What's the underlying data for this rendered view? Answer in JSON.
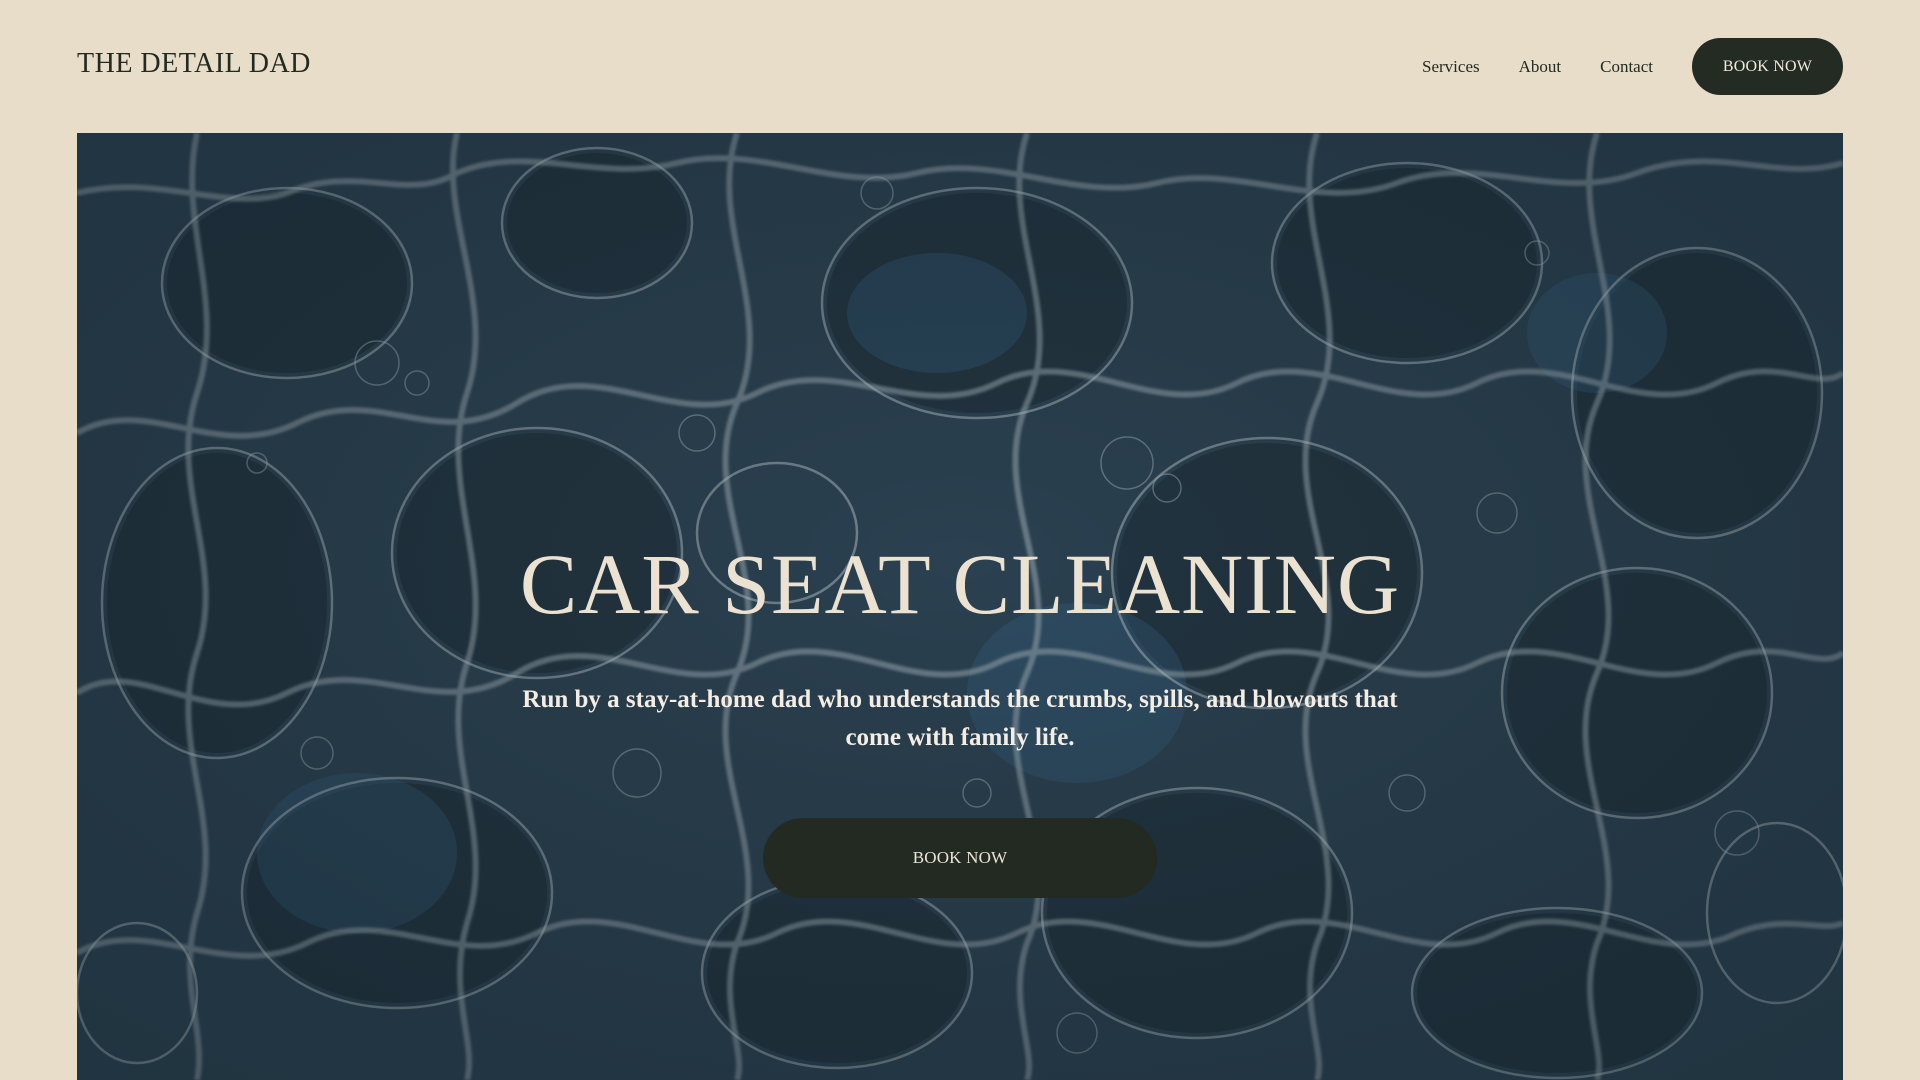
{
  "header": {
    "logo": "THE DETAIL DAD",
    "nav": [
      {
        "label": "Services"
      },
      {
        "label": "About"
      },
      {
        "label": "Contact"
      }
    ],
    "cta_label": "BOOK NOW"
  },
  "hero": {
    "title": "CAR SEAT CLEANING",
    "subtitle": "Run by a stay-at-home dad who understands the crumbs, spills, and blowouts that come with family life.",
    "cta_label": "BOOK NOW",
    "background_image": "soap-bubbles-foam-closeup"
  },
  "colors": {
    "page_bg": "#e8ddc9",
    "dark": "#232a22",
    "hero_text": "#ece2d2",
    "bubble_base": "#2e4455"
  }
}
